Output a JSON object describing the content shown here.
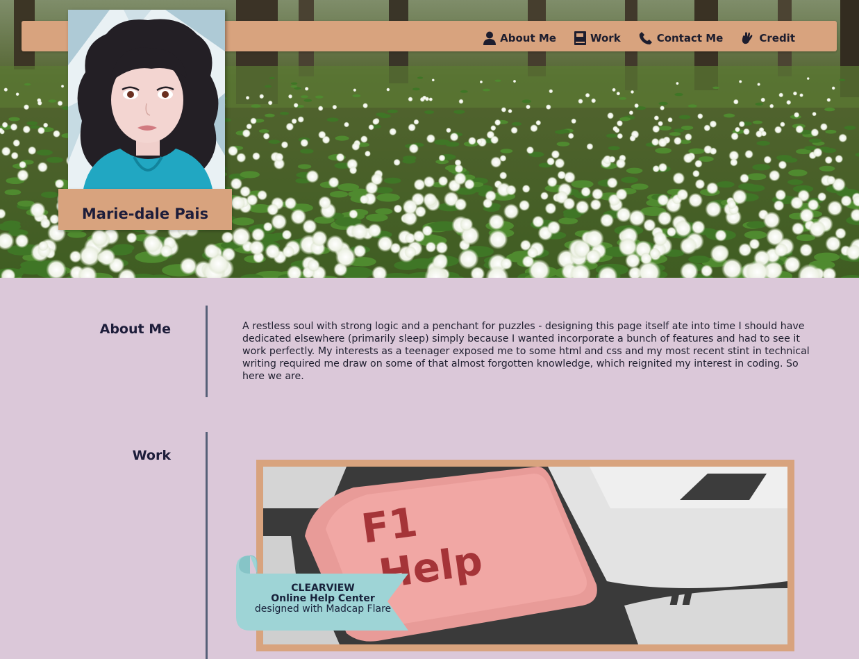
{
  "nav": {
    "items": [
      {
        "label": "About Me",
        "icon": "user-icon"
      },
      {
        "label": "Work",
        "icon": "book-icon"
      },
      {
        "label": "Contact Me",
        "icon": "phone-icon"
      },
      {
        "label": "Credit",
        "icon": "hand-icon"
      }
    ]
  },
  "profile": {
    "name": "Marie-dale Pais"
  },
  "about": {
    "title": "About Me",
    "text": "A restless soul with strong logic and a penchant for puzzles - designing this page itself ate into time I should have dedicated elsewhere (primarily sleep) simply because I wanted incorporate a bunch of features and had to see it work perfectly. My interests as a teenager exposed me to some html and css and my most recent stint in technical writing required me draw on some of that almost forgotten knowledge, which reignited my interest in coding. So here we are."
  },
  "work": {
    "title": "Work",
    "key_text_top": "F1",
    "key_text_bottom": "Help",
    "ribbon": {
      "line1": "CLEARVIEW",
      "line2": "Online Help Center",
      "line3": "designed with Madcap Flare"
    }
  },
  "colors": {
    "background": "#dbc8d9",
    "accent": "#d8a37e",
    "ribbon": "#9ed4d6",
    "text": "#1d1d3a",
    "divider": "#566078"
  }
}
